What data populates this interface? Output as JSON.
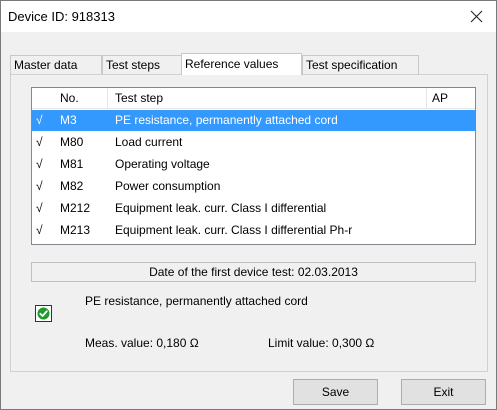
{
  "window": {
    "title": "Device ID: 918313",
    "close_icon": "close-icon"
  },
  "tabs": [
    {
      "label": "Master data",
      "active": false
    },
    {
      "label": "Test steps",
      "active": false
    },
    {
      "label": "Reference values",
      "active": true
    },
    {
      "label": "Test specification",
      "active": false
    }
  ],
  "list": {
    "columns": [
      "No.",
      "Test step",
      "AP"
    ],
    "rows": [
      {
        "check": "√",
        "no": "M3",
        "step": "PE resistance, permanently attached cord",
        "selected": true
      },
      {
        "check": "√",
        "no": "M80",
        "step": "Load current",
        "selected": false
      },
      {
        "check": "√",
        "no": "M81",
        "step": "Operating voltage",
        "selected": false
      },
      {
        "check": "√",
        "no": "M82",
        "step": "Power consumption",
        "selected": false
      },
      {
        "check": "√",
        "no": "M212",
        "step": "Equipment leak. curr. Class I differential",
        "selected": false
      },
      {
        "check": "√",
        "no": "M213",
        "step": "Equipment leak. curr. Class I differential Ph-r",
        "selected": false
      }
    ]
  },
  "details": {
    "first_test": "Date of the first device test: 02.03.2013",
    "status_icon": "check-circle-icon",
    "status_color": "#1e9b2a",
    "step_name": "PE resistance, permanently attached cord",
    "meas_value": "Meas. value: 0,180 Ω",
    "limit_value": "Limit value: 0,300 Ω"
  },
  "buttons": {
    "save": "Save",
    "exit": "Exit"
  },
  "colors": {
    "selection": "#3399ff"
  }
}
